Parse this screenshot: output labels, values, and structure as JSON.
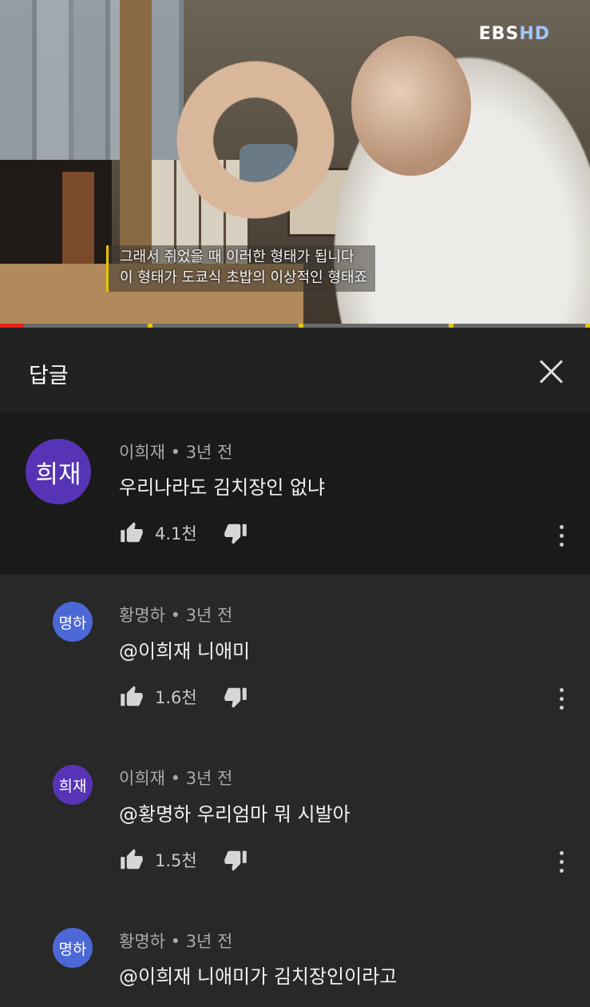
{
  "video": {
    "logo_main": "EBS",
    "logo_hd": "HD",
    "subtitle_line1": "그래서 쥐었을 때 이러한 형태가 됩니다",
    "subtitle_line2": "이 형태가 도쿄식 초밥의 이상적인 형태죠",
    "progress_fraction": 0.04
  },
  "panel": {
    "title": "답글",
    "close_icon": "close-icon"
  },
  "colors": {
    "panel_bg": "#282828",
    "main_comment_bg": "#1a1a1a",
    "avatar_purple": "#5734b5",
    "avatar_blue": "#4c68d6",
    "progress_red": "#e62117",
    "ad_marker_yellow": "#e8c400"
  },
  "comments": [
    {
      "avatar_text": "희재",
      "meta": "이희재 • 3년 전",
      "text": "우리나라도 김치장인 없냐",
      "likes": "4.1천"
    },
    {
      "avatar_text": "명하",
      "meta": "황명하 • 3년 전",
      "text": "@이희재 니애미",
      "likes": "1.6천"
    },
    {
      "avatar_text": "희재",
      "meta": "이희재 • 3년 전",
      "text": "@황명하 우리엄마 뭐 시발아",
      "likes": "1.5천"
    },
    {
      "avatar_text": "명하",
      "meta": "황명하 • 3년 전",
      "text": "@이희재 니애미가 김치장인이라고"
    }
  ]
}
